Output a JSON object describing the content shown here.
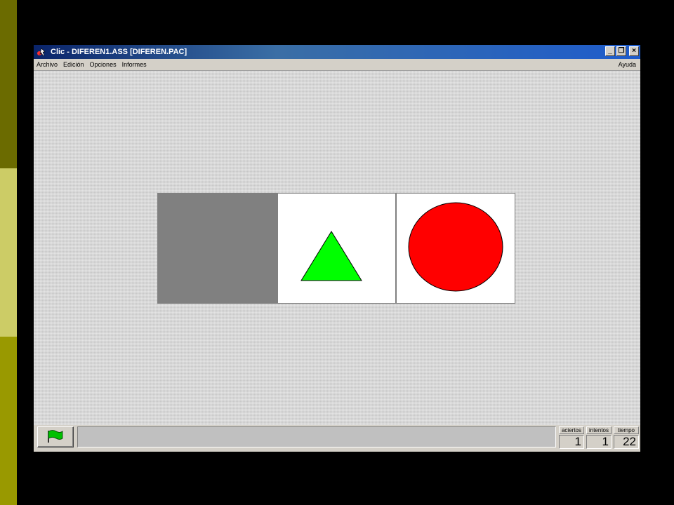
{
  "window": {
    "title": "Clic - DIFEREN1.ASS [DIFEREN.PAC]",
    "minimize": "_",
    "restore": "❐",
    "close": "×"
  },
  "menu": {
    "left": [
      "Archivo",
      "Edición",
      "Opciones",
      "Informes"
    ],
    "right": "Ayuda"
  },
  "board": {
    "cells": [
      {
        "name": "hidden-tile",
        "fill": "#808080"
      },
      {
        "name": "triangle",
        "fill": "#00ff00",
        "stroke": "#000000"
      },
      {
        "name": "circle",
        "fill": "#ff0000",
        "stroke": "#000000"
      }
    ]
  },
  "status": {
    "start_icon": "green-flag-icon",
    "message": "",
    "counters": [
      {
        "label": "aciertos",
        "value": "1"
      },
      {
        "label": "intentos",
        "value": "1"
      },
      {
        "label": "tiempo",
        "value": "22"
      }
    ]
  }
}
